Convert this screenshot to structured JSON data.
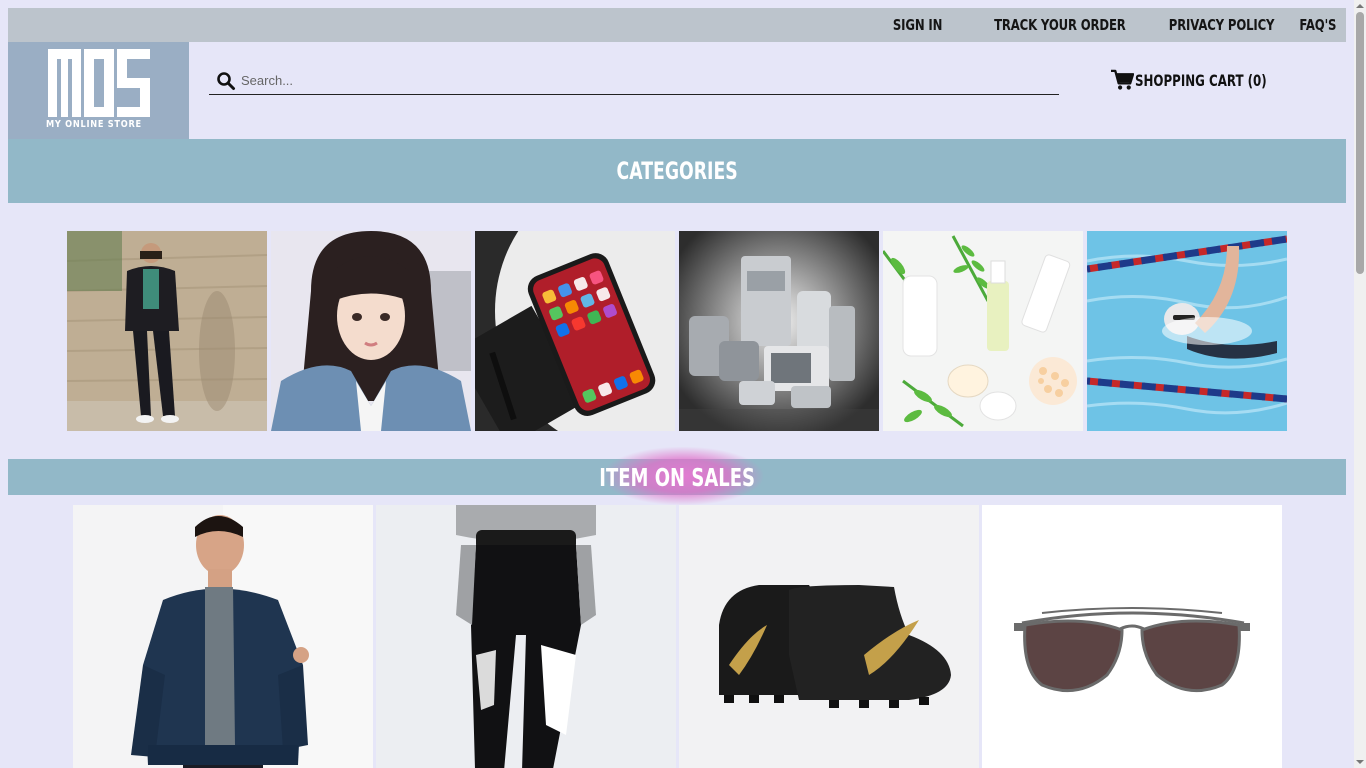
{
  "topbar": {
    "links": [
      "SIGN IN",
      "TRACK YOUR ORDER",
      "PRIVACY POLICY",
      "FAQ'S"
    ]
  },
  "logo": {
    "mark": "MOS",
    "tagline": "MY ONLINE STORE"
  },
  "search": {
    "placeholder": "Search...",
    "icon": "search-icon"
  },
  "cart": {
    "label": "SHOPPING CART (0)",
    "icon": "cart-icon"
  },
  "categories": {
    "title": "CATEGORIES",
    "tiles": [
      {
        "icon": "mens-fashion-photo"
      },
      {
        "icon": "womens-fashion-photo"
      },
      {
        "icon": "smartphone-photo"
      },
      {
        "icon": "home-appliances-photo"
      },
      {
        "icon": "cosmetics-photo"
      },
      {
        "icon": "sports-swimming-photo"
      }
    ]
  },
  "sales": {
    "title": "ITEM ON SALES",
    "items": [
      {
        "icon": "bomber-jacket-photo"
      },
      {
        "icon": "track-pants-photo"
      },
      {
        "icon": "football-boots-photo"
      },
      {
        "icon": "aviator-sunglasses-photo"
      }
    ]
  },
  "colors": {
    "background": "#e6e6f8",
    "topbar": "#bcc4cc",
    "logo_bg": "#9aaec4",
    "banner": "#92b8c8",
    "highlight_glow": "#e078d0"
  }
}
